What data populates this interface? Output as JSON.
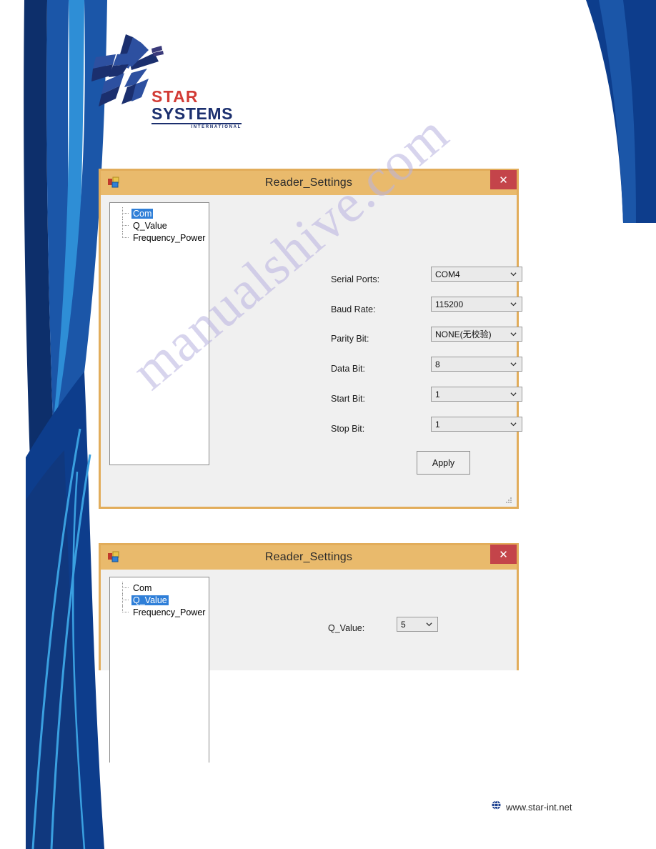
{
  "brand": {
    "logo_line1": "STAR",
    "logo_line2": "SYSTEMS",
    "logo_line3": "INTERNATIONAL"
  },
  "watermark": {
    "text": "manualshive.com"
  },
  "footer": {
    "url": "www.star-int.net",
    "icon": "globe-icon"
  },
  "dialog_com": {
    "title": "Reader_Settings",
    "close_label": "✕",
    "app_icon": "application-icon",
    "tree": {
      "items": [
        {
          "label": "Com",
          "selected": true
        },
        {
          "label": "Q_Value",
          "selected": false
        },
        {
          "label": "Frequency_Power",
          "selected": false
        }
      ]
    },
    "fields": [
      {
        "label": "Serial Ports:",
        "value": "COM4"
      },
      {
        "label": "Baud Rate:",
        "value": "115200"
      },
      {
        "label": "Parity Bit:",
        "value": "NONE(无校验)"
      },
      {
        "label": "Data Bit:",
        "value": "8"
      },
      {
        "label": "Start Bit:",
        "value": "1"
      },
      {
        "label": "Stop Bit:",
        "value": "1"
      }
    ],
    "apply_label": "Apply"
  },
  "dialog_qvalue": {
    "title": "Reader_Settings",
    "close_label": "✕",
    "app_icon": "application-icon",
    "tree": {
      "items": [
        {
          "label": "Com",
          "selected": false
        },
        {
          "label": "Q_Value",
          "selected": true
        },
        {
          "label": "Frequency_Power",
          "selected": false
        }
      ]
    },
    "fields": [
      {
        "label": "Q_Value:",
        "value": "5"
      }
    ]
  },
  "colors": {
    "window_border": "#e2ad5b",
    "titlebar": "#e9ba6c",
    "close_button": "#c4444a",
    "tree_selection": "#2f7fd8",
    "logo_red": "#d23b35",
    "logo_blue": "#1b2f6e",
    "deco_dark_blue": "#10387e",
    "deco_blue": "#1b56a8",
    "deco_light_blue": "#2e8ed6",
    "watermark": "#b9b3e0"
  }
}
